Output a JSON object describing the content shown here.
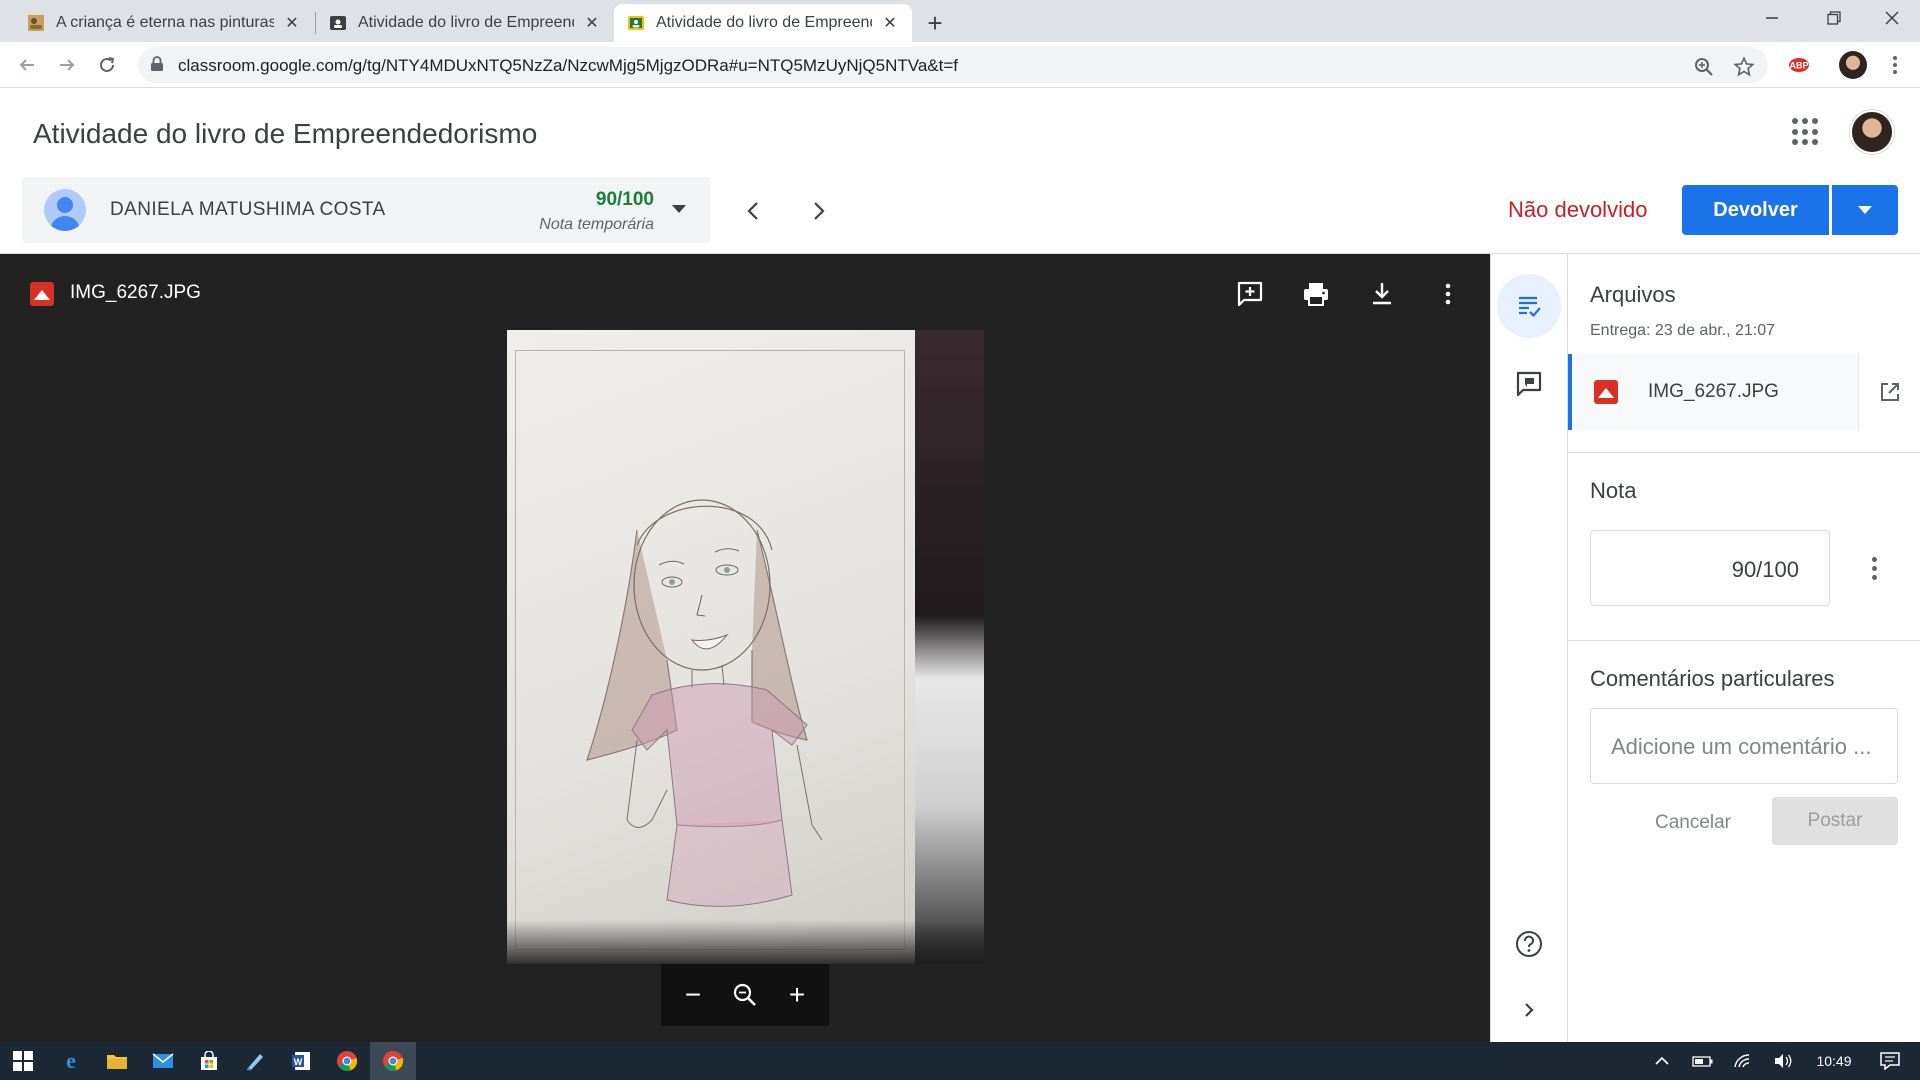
{
  "browser": {
    "tabs": [
      {
        "title": "A criança é eterna nas pinturas d",
        "favicon": "painting-icon",
        "active": false
      },
      {
        "title": "Atividade do livro de Empreende",
        "favicon": "classroom-icon",
        "active": false
      },
      {
        "title": "Atividade do livro de Empreende",
        "favicon": "classroom-icon",
        "active": true
      }
    ],
    "new_tab_label": "+",
    "url": "classroom.google.com/g/tg/NTY4MDUxNTQ5NzZa/NzcwMjg5MjgzODRa#u=NTQ5MzUyNjQ5NTVa&t=f"
  },
  "header": {
    "title": "Atividade do livro de Empreendedorismo"
  },
  "student": {
    "name": "DANIELA MATUSHIMA COSTA",
    "grade": "90/100",
    "grade_note": "Nota temporária",
    "status": "Não devolvido",
    "return_button": "Devolver"
  },
  "viewer": {
    "filename": "IMG_6267.JPG",
    "zoom_out": "−",
    "zoom_in": "+"
  },
  "panel": {
    "files_heading": "Arquivos",
    "submitted": "Entrega: 23 de abr., 21:07",
    "file_name": "IMG_6267.JPG",
    "grade_heading": "Nota",
    "grade_value": "90/100",
    "comments_heading": "Comentários particulares",
    "comment_placeholder": "Adicione um comentário ...",
    "cancel_label": "Cancelar",
    "post_label": "Postar"
  },
  "taskbar": {
    "time": "10:49"
  },
  "colors": {
    "accent": "#1a73e8",
    "status_red": "#c5221f",
    "grade_green": "#188038",
    "viewer_bg": "#222222",
    "taskbar_bg": "#1c2833"
  }
}
